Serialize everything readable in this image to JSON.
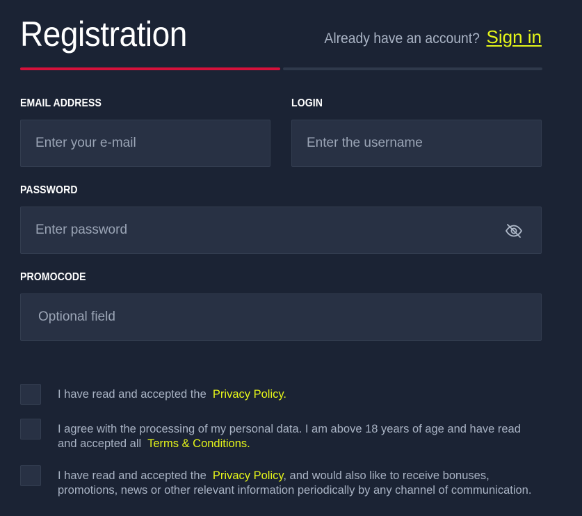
{
  "header": {
    "title": "Registration",
    "signin_prompt": "Already have an account?",
    "signin_link": "Sign in"
  },
  "progress": {
    "current_step": 1,
    "total_steps": 2
  },
  "fields": {
    "email": {
      "label": "EMAIL ADDRESS",
      "placeholder": "Enter your e-mail",
      "value": ""
    },
    "login": {
      "label": "LOGIN",
      "placeholder": "Enter the username",
      "value": ""
    },
    "password": {
      "label": "PASSWORD",
      "placeholder": "Enter password",
      "value": "",
      "toggle_icon": "eye-off-icon"
    },
    "promocode": {
      "label": "PROMOCODE",
      "placeholder": "Optional field",
      "value": ""
    }
  },
  "consents": [
    {
      "checked": false,
      "text_before": "I have read and accepted the",
      "link": "Privacy Policy.",
      "text_after": ""
    },
    {
      "checked": false,
      "text_before": "I agree with the processing of my personal data. I am above 18 years of age and have read and accepted all",
      "link": "Terms & Conditions.",
      "text_after": ""
    },
    {
      "checked": false,
      "text_before": "I have read and accepted the",
      "link": "Privacy Policy",
      "text_after": ", and would also like to receive bonuses, promotions, news or other relevant information periodically by any channel of communication."
    }
  ],
  "colors": {
    "background": "#1b2334",
    "input_background": "#283144",
    "accent_link": "#e6f619",
    "progress_active": "#d5113b",
    "progress_inactive": "#2f394b",
    "muted_text": "#a9b3c4"
  }
}
